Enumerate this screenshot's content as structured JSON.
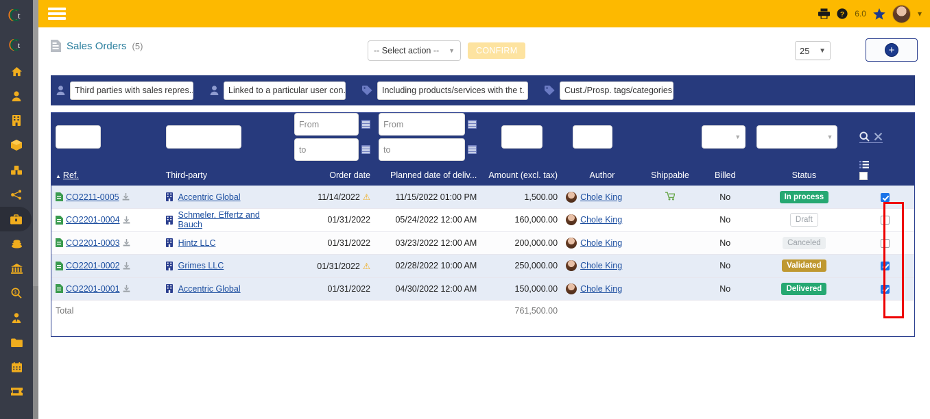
{
  "topbar": {
    "menu_icon": "hamburger-icon",
    "print_icon": "printer-icon",
    "help_icon": "help-circle-icon",
    "version": "6.0",
    "bookmark_icon": "star-icon",
    "avatar_icon": "user-avatar",
    "caret_icon": "chevron-down-icon",
    "bg": "#fdb900"
  },
  "header": {
    "doc_icon": "document-icon",
    "title": "Sales Orders",
    "count": "(5)",
    "action_select": "-- Select action --",
    "action_caret": "chevron-down-icon",
    "confirm_label": "CONFIRM",
    "page_size": "25",
    "page_size_caret": "chevron-down-icon",
    "new_icon": "plus-circle-icon"
  },
  "filters": [
    {
      "icon": "user-icon",
      "label": "Third parties with sales repres..",
      "caret": "chevron-down-icon"
    },
    {
      "icon": "user-icon",
      "label": "Linked to a particular user con.",
      "caret": "chevron-down-icon"
    },
    {
      "icon": "tag-icon",
      "label": "Including products/services with the t.",
      "caret": "chevron-down-icon"
    },
    {
      "icon": "tag-icon",
      "label": "Cust./Prosp. tags/categories",
      "caret": ""
    }
  ],
  "table": {
    "search": {
      "ref": "",
      "third_party": "",
      "order_date_from": "From",
      "order_date_to": "to",
      "planned_date_from": "From",
      "planned_date_to": "to",
      "amount": "",
      "author": "",
      "billed": "",
      "status": "",
      "search_icon": "magnifier-icon",
      "clear_icon": "close-x-icon",
      "column_picker_icon": "list-columns-icon",
      "select_all_checkbox": "checkbox-unchecked"
    },
    "columns": [
      "Ref.",
      "Third-party",
      "Order date",
      "Planned date of deliv...",
      "Amount (excl. tax)",
      "Author",
      "Shippable",
      "Billed",
      "Status",
      ""
    ],
    "sort_column": "Ref.",
    "sort_dir_icon": "caret-up-icon",
    "rows": [
      {
        "ref": "CO2211-0005",
        "third_party": "Accentric Global",
        "order_date": "11/14/2022",
        "order_date_warning": true,
        "planned_date": "11/15/2022 01:00 PM",
        "amount": "1,500.00",
        "author": "Chole King",
        "shippable": "shipping-cart-icon",
        "billed": "No",
        "status": "In process",
        "status_color": "#26a872",
        "selected": true
      },
      {
        "ref": "CO2201-0004",
        "third_party": "Schmeler, Effertz and Bauch",
        "order_date": "01/31/2022",
        "order_date_warning": false,
        "planned_date": "05/24/2022 12:00 AM",
        "amount": "160,000.00",
        "author": "Chole King",
        "shippable": "",
        "billed": "No",
        "status": "Draft",
        "status_color": "#ffffff",
        "selected": false
      },
      {
        "ref": "CO2201-0003",
        "third_party": "Hintz LLC",
        "order_date": "01/31/2022",
        "order_date_warning": false,
        "planned_date": "03/23/2022 12:00 AM",
        "amount": "200,000.00",
        "author": "Chole King",
        "shippable": "",
        "billed": "No",
        "status": "Canceled",
        "status_color": "#eceff1",
        "selected": false
      },
      {
        "ref": "CO2201-0002",
        "third_party": "Grimes LLC",
        "order_date": "01/31/2022",
        "order_date_warning": true,
        "planned_date": "02/28/2022 10:00 AM",
        "amount": "250,000.00",
        "author": "Chole King",
        "shippable": "",
        "billed": "No",
        "status": "Validated",
        "status_color": "#bf9830",
        "selected": true
      },
      {
        "ref": "CO2201-0001",
        "third_party": "Accentric Global",
        "order_date": "01/31/2022",
        "order_date_warning": false,
        "planned_date": "04/30/2022 12:00 AM",
        "amount": "150,000.00",
        "author": "Chole King",
        "shippable": "",
        "billed": "No",
        "status": "Delivered",
        "status_color": "#26a872",
        "selected": true
      }
    ],
    "total_label": "Total",
    "total_amount": "761,500.00"
  },
  "sidebar": {
    "items": [
      {
        "icon": "logo-icon",
        "name": "logo"
      },
      {
        "icon": "logo-small-icon",
        "name": "logo-small"
      },
      {
        "icon": "home-icon",
        "name": "home"
      },
      {
        "icon": "user-icon",
        "name": "members"
      },
      {
        "icon": "building-icon",
        "name": "third-parties"
      },
      {
        "icon": "box-icon",
        "name": "products"
      },
      {
        "icon": "boxes-icon",
        "name": "stock"
      },
      {
        "icon": "share-nodes-icon",
        "name": "mrp"
      },
      {
        "icon": "briefcase-icon",
        "name": "commercial",
        "active": true
      },
      {
        "icon": "coins-icon",
        "name": "billing"
      },
      {
        "icon": "bank-icon",
        "name": "bank"
      },
      {
        "icon": "magnifier-dollar-icon",
        "name": "accounting"
      },
      {
        "icon": "person-tie-icon",
        "name": "hrm"
      },
      {
        "icon": "folder-icon",
        "name": "projects"
      },
      {
        "icon": "calendar-icon",
        "name": "agenda"
      },
      {
        "icon": "ticket-icon",
        "name": "tickets"
      }
    ]
  },
  "colors": {
    "top_bar": "#fdb900",
    "filter_bar": "#273a7d",
    "table_header": "#273a7d",
    "accent_blue": "#1d4fa0",
    "highlight_box": "#ee0000"
  }
}
